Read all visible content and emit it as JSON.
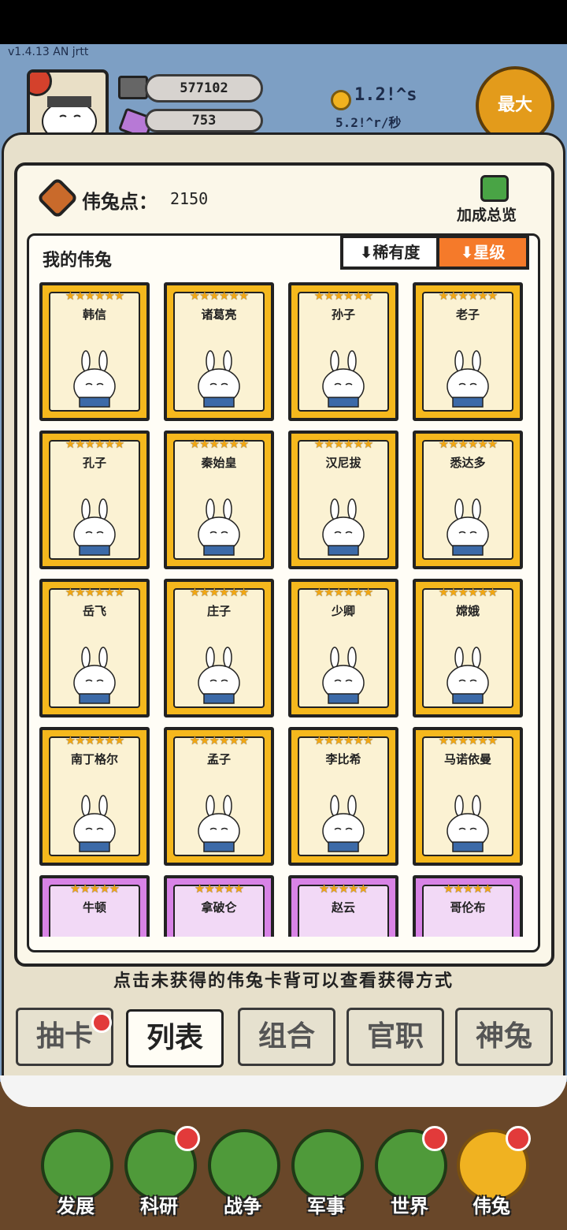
{
  "version": "v1.4.13 AN jrtt",
  "resources": {
    "gold_bars": "577102",
    "gems": "753"
  },
  "coin_rate": {
    "value": "1.2!^s",
    "per_second": "5.2!^r/秒"
  },
  "max_button": "最大",
  "wei_points": {
    "label": "伟兔点：",
    "value": "2150"
  },
  "bonus_overview": "加成总览",
  "list": {
    "title": "我的伟兔",
    "sort_rarity": "稀有度",
    "sort_star": "星级",
    "cards": [
      {
        "name": "韩信",
        "stars": "★★★★★★",
        "rarity": "gold"
      },
      {
        "name": "诸葛亮",
        "stars": "★★★★★★",
        "rarity": "gold"
      },
      {
        "name": "孙子",
        "stars": "★★★★★★",
        "rarity": "gold"
      },
      {
        "name": "老子",
        "stars": "★★★★★★",
        "rarity": "gold"
      },
      {
        "name": "孔子",
        "stars": "★★★★★★",
        "rarity": "gold"
      },
      {
        "name": "秦始皇",
        "stars": "★★★★★★",
        "rarity": "gold"
      },
      {
        "name": "汉尼拔",
        "stars": "★★★★★★",
        "rarity": "gold"
      },
      {
        "name": "悉达多",
        "stars": "★★★★★★",
        "rarity": "gold"
      },
      {
        "name": "岳飞",
        "stars": "★★★★★★",
        "rarity": "gold"
      },
      {
        "name": "庄子",
        "stars": "★★★★★★",
        "rarity": "gold"
      },
      {
        "name": "少卿",
        "stars": "★★★★★★",
        "rarity": "gold"
      },
      {
        "name": "嫦娥",
        "stars": "★★★★★★",
        "rarity": "gold"
      },
      {
        "name": "南丁格尔",
        "stars": "★★★★★★",
        "rarity": "gold"
      },
      {
        "name": "孟子",
        "stars": "★★★★★★",
        "rarity": "gold"
      },
      {
        "name": "李比希",
        "stars": "★★★★★★",
        "rarity": "gold"
      },
      {
        "name": "马诺依曼",
        "stars": "★★★★★★",
        "rarity": "gold"
      },
      {
        "name": "牛顿",
        "stars": "★★★★★",
        "rarity": "purple"
      },
      {
        "name": "拿破仑",
        "stars": "★★★★★",
        "rarity": "purple"
      },
      {
        "name": "赵云",
        "stars": "★★★★★",
        "rarity": "purple"
      },
      {
        "name": "哥伦布",
        "stars": "★★★★★",
        "rarity": "purple"
      }
    ]
  },
  "hint": "点击未获得的伟兔卡背可以查看获得方式",
  "tabs": [
    "抽卡",
    "列表",
    "组合",
    "官职",
    "神兔"
  ],
  "nav": [
    "发展",
    "科研",
    "战争",
    "军事",
    "世界",
    "伟兔"
  ]
}
